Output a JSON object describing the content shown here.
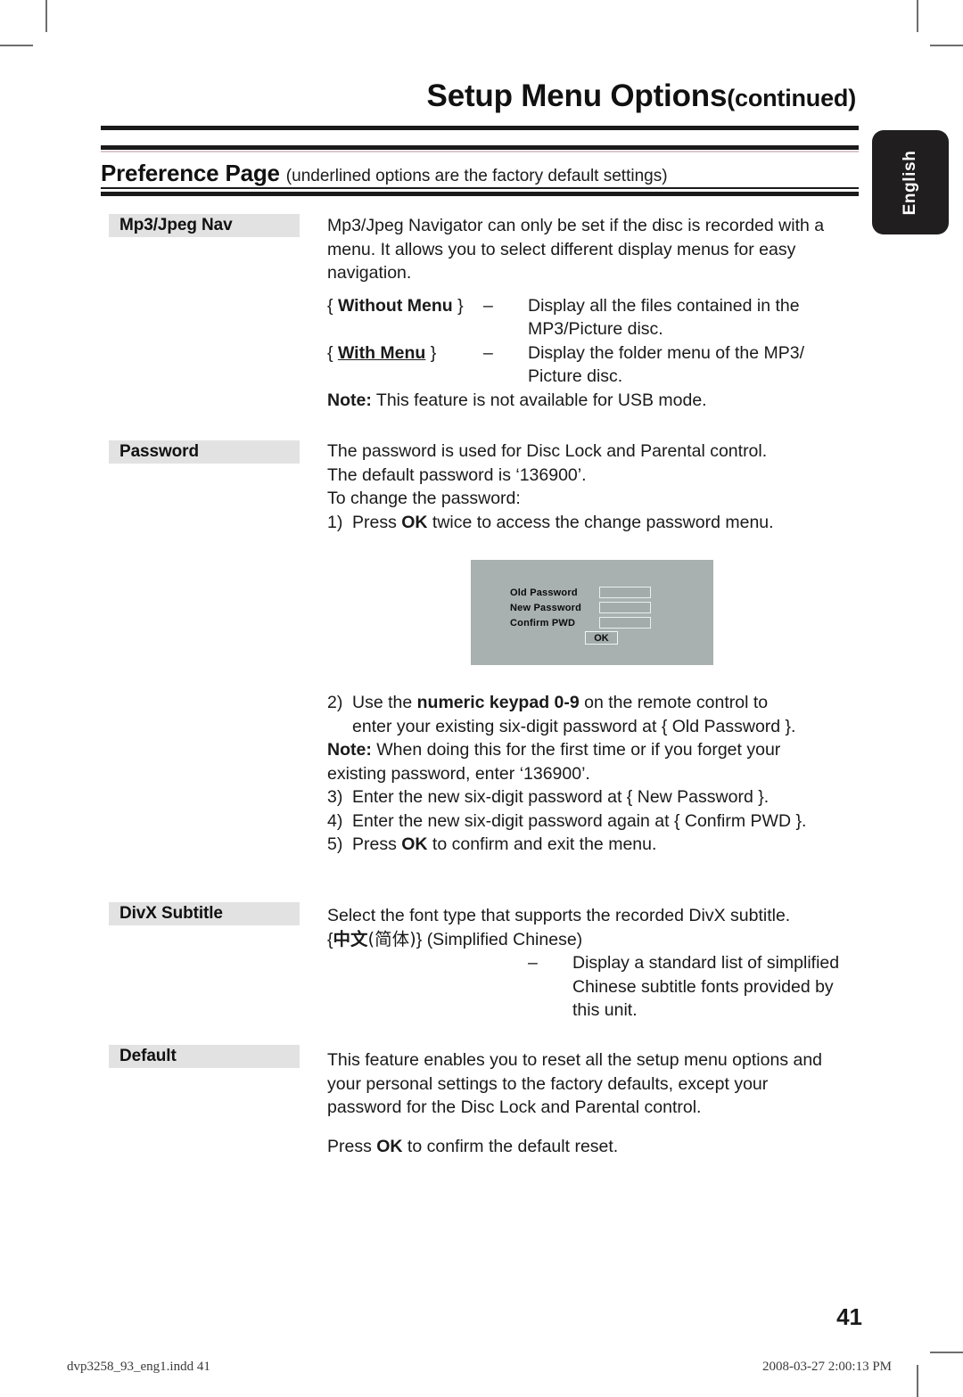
{
  "header": {
    "title_main": "Setup Menu Options",
    "title_continued": "(continued)"
  },
  "preference_bar": {
    "title": "Preference Page",
    "subtitle": "(underlined options are the factory default settings)"
  },
  "language_tab": {
    "label": "English"
  },
  "sections": [
    {
      "label": "Mp3/Jpeg Nav",
      "intro": [
        "Mp3/Jpeg Navigator can only be set if the disc is recorded with a",
        "menu. It allows you to select different display menus for easy",
        "navigation."
      ],
      "options": [
        {
          "key_open": "{",
          "key": "Without Menu",
          "key_close": "}",
          "underlined": false,
          "dash": "–",
          "value_lines": [
            "Display all the files contained in the",
            "MP3/Picture disc."
          ]
        },
        {
          "key_open": "{",
          "key": "With Menu",
          "key_close": "}",
          "underlined": true,
          "dash": "–",
          "value_lines": [
            "Display the folder menu of the MP3/",
            "Picture disc."
          ]
        }
      ],
      "note_label": "Note:",
      "note_text": "This feature is not available for USB mode."
    },
    {
      "label": "Password",
      "lines": [
        "The password is used for Disc Lock and Parental control.",
        "The default password is ‘136900’.",
        "To change the password:"
      ],
      "step1": {
        "num": "1)",
        "pre": "Press ",
        "key": "OK",
        "post": " twice to access the change password menu."
      },
      "steps_after": [
        {
          "num": "2)",
          "lines": [
            {
              "pre": "Use the ",
              "key": "numeric keypad 0-9",
              "post": " on the remote control to"
            },
            {
              "pre": "enter your existing six-digit password at { Old Password }.",
              "key": "",
              "post": ""
            }
          ]
        }
      ],
      "note2_label": "Note:",
      "note2_lines": [
        "When doing this for the first time or if you forget your",
        "existing password, enter ‘136900’."
      ],
      "step3": {
        "num": "3)",
        "text": "Enter the new six-digit password at { New Password }."
      },
      "step4": {
        "num": "4)",
        "text": "Enter the new six-digit password again at { Confirm PWD }."
      },
      "step5": {
        "num": "5)",
        "pre": "Press ",
        "key": "OK",
        "post": " to confirm and exit the menu."
      }
    },
    {
      "label": "DivX Subtitle",
      "line1": "Select the font type that supports the recorded DivX subtitle.",
      "option_line": "{ 中文(简体) } (Simplified Chinese)",
      "option_cjk_bold": "中文",
      "option_cjk_rest": "(简体)",
      "option_suffix": "(Simplified Chinese)",
      "dash": "–",
      "desc_lines": [
        "Display a standard list of simplified",
        "Chinese subtitle fonts provided by",
        "this unit."
      ]
    },
    {
      "label": "Default",
      "lines": [
        "This feature enables you to reset all the setup menu options and",
        "your personal settings to the factory defaults, except your",
        "password for the Disc Lock and Parental control."
      ],
      "confirm": {
        "pre": "Press ",
        "key": "OK",
        "post": " to confirm the default reset."
      }
    }
  ],
  "osd_dialog": {
    "rows": [
      {
        "label": "Old  Password",
        "value": ""
      },
      {
        "label": "New Password",
        "value": ""
      },
      {
        "label": "Confirm PWD",
        "value": ""
      }
    ],
    "ok_label": "OK",
    "background_color": "#a8b0b0"
  },
  "footer": {
    "page_number": "41",
    "file_name": "dvp3258_93_eng1.indd   41",
    "timestamp": "2008-03-27   2:00:13 PM"
  }
}
